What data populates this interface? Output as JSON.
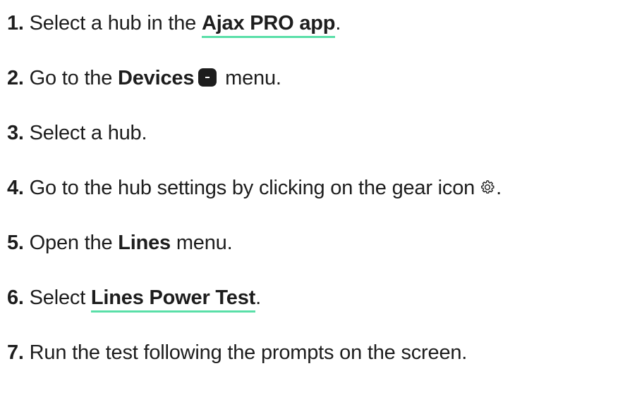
{
  "steps": [
    {
      "num": "1.",
      "pre": "Select a hub in the",
      "link": "Ajax PRO app",
      "post": "."
    },
    {
      "num": "2.",
      "pre": "Go to the",
      "bold": "Devices",
      "icon": "devices-icon",
      "post": "menu."
    },
    {
      "num": "3.",
      "pre": "Select a hub."
    },
    {
      "num": "4.",
      "pre": "Go to the hub settings by clicking on the gear icon",
      "icon": "gear-icon",
      "post": "."
    },
    {
      "num": "5.",
      "pre": "Open the",
      "bold": "Lines",
      "post": "menu."
    },
    {
      "num": "6.",
      "pre": "Select",
      "link": "Lines Power Test",
      "post": "."
    },
    {
      "num": "7.",
      "pre": "Run the test following the prompts on the screen."
    }
  ],
  "colors": {
    "text": "#1d1d1d",
    "link_underline": "#59dfa8"
  }
}
